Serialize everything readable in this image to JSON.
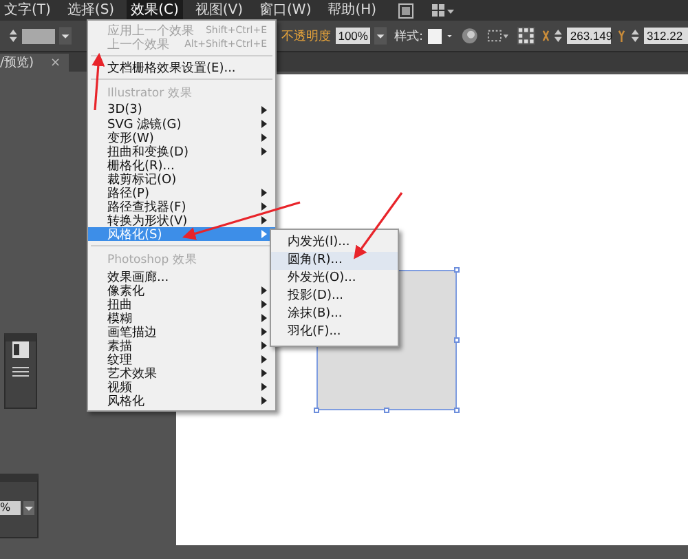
{
  "menubar": [
    {
      "label": "文字(T)",
      "selected": false
    },
    {
      "label": "选择(S)",
      "selected": false
    },
    {
      "label": "效果(C)",
      "selected": true
    },
    {
      "label": "视图(V)",
      "selected": false
    },
    {
      "label": "窗口(W)",
      "selected": false
    },
    {
      "label": "帮助(H)",
      "selected": false
    }
  ],
  "control_bar": {
    "opacity_label": "不透明度",
    "opacity_value": "100%",
    "style_label": "样式:",
    "x_value": "263.149",
    "y_value": "312.22"
  },
  "document_tab": {
    "title": "/预览)",
    "close": "×"
  },
  "effect_menu": [
    {
      "kind": "item",
      "label": "应用上一个效果",
      "shortcut": "Shift+Ctrl+E",
      "disabled": true,
      "submenu": false,
      "selected": false
    },
    {
      "kind": "item",
      "label": "上一个效果",
      "shortcut": "Alt+Shift+Ctrl+E",
      "disabled": true,
      "submenu": false,
      "selected": false
    },
    {
      "kind": "separator"
    },
    {
      "kind": "item",
      "label": "文档栅格效果设置(E)...",
      "disabled": false,
      "submenu": false,
      "selected": false
    },
    {
      "kind": "separator"
    },
    {
      "kind": "header",
      "label": "Illustrator 效果"
    },
    {
      "kind": "item",
      "label": "3D(3)",
      "disabled": false,
      "submenu": true,
      "selected": false
    },
    {
      "kind": "item",
      "label": "SVG 滤镜(G)",
      "disabled": false,
      "submenu": true,
      "selected": false
    },
    {
      "kind": "item",
      "label": "变形(W)",
      "disabled": false,
      "submenu": true,
      "selected": false
    },
    {
      "kind": "item",
      "label": "扭曲和变换(D)",
      "disabled": false,
      "submenu": true,
      "selected": false
    },
    {
      "kind": "item",
      "label": "栅格化(R)...",
      "disabled": false,
      "submenu": false,
      "selected": false
    },
    {
      "kind": "item",
      "label": "裁剪标记(O)",
      "disabled": false,
      "submenu": false,
      "selected": false
    },
    {
      "kind": "item",
      "label": "路径(P)",
      "disabled": false,
      "submenu": true,
      "selected": false
    },
    {
      "kind": "item",
      "label": "路径查找器(F)",
      "disabled": false,
      "submenu": true,
      "selected": false
    },
    {
      "kind": "item",
      "label": "转换为形状(V)",
      "disabled": false,
      "submenu": true,
      "selected": false
    },
    {
      "kind": "item",
      "label": "风格化(S)",
      "disabled": false,
      "submenu": true,
      "selected": true
    },
    {
      "kind": "separator"
    },
    {
      "kind": "header",
      "label": "Photoshop 效果"
    },
    {
      "kind": "item",
      "label": "效果画廊...",
      "disabled": false,
      "submenu": false,
      "selected": false
    },
    {
      "kind": "item",
      "label": "像素化",
      "disabled": false,
      "submenu": true,
      "selected": false
    },
    {
      "kind": "item",
      "label": "扭曲",
      "disabled": false,
      "submenu": true,
      "selected": false
    },
    {
      "kind": "item",
      "label": "模糊",
      "disabled": false,
      "submenu": true,
      "selected": false
    },
    {
      "kind": "item",
      "label": "画笔描边",
      "disabled": false,
      "submenu": true,
      "selected": false
    },
    {
      "kind": "item",
      "label": "素描",
      "disabled": false,
      "submenu": true,
      "selected": false
    },
    {
      "kind": "item",
      "label": "纹理",
      "disabled": false,
      "submenu": true,
      "selected": false
    },
    {
      "kind": "item",
      "label": "艺术效果",
      "disabled": false,
      "submenu": true,
      "selected": false
    },
    {
      "kind": "item",
      "label": "视频",
      "disabled": false,
      "submenu": true,
      "selected": false
    },
    {
      "kind": "item",
      "label": "风格化",
      "disabled": false,
      "submenu": true,
      "selected": false
    }
  ],
  "stylize_submenu": [
    {
      "label": "内发光(I)...",
      "selected": false
    },
    {
      "label": "圆角(R)...",
      "selected": true
    },
    {
      "label": "外发光(O)...",
      "selected": false
    },
    {
      "label": "投影(D)...",
      "selected": false
    },
    {
      "label": "涂抹(B)...",
      "selected": false
    },
    {
      "label": "羽化(F)...",
      "selected": false
    }
  ],
  "panel_field": {
    "value": "%"
  }
}
